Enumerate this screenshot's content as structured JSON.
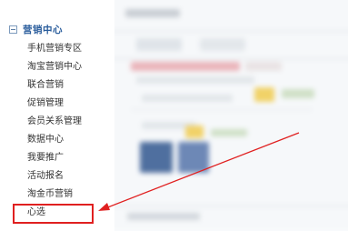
{
  "sidebar": {
    "group_title": "营销中心",
    "items": [
      {
        "label": "手机营销专区"
      },
      {
        "label": "淘宝营销中心"
      },
      {
        "label": "联合营销"
      },
      {
        "label": "促销管理"
      },
      {
        "label": "会员关系管理"
      },
      {
        "label": "数据中心"
      },
      {
        "label": "我要推广"
      },
      {
        "label": "活动报名"
      },
      {
        "label": "淘金币营销"
      },
      {
        "label": "心选"
      }
    ]
  },
  "annotation": {
    "highlight_color": "#e02020",
    "arrow_color": "#e02020"
  }
}
